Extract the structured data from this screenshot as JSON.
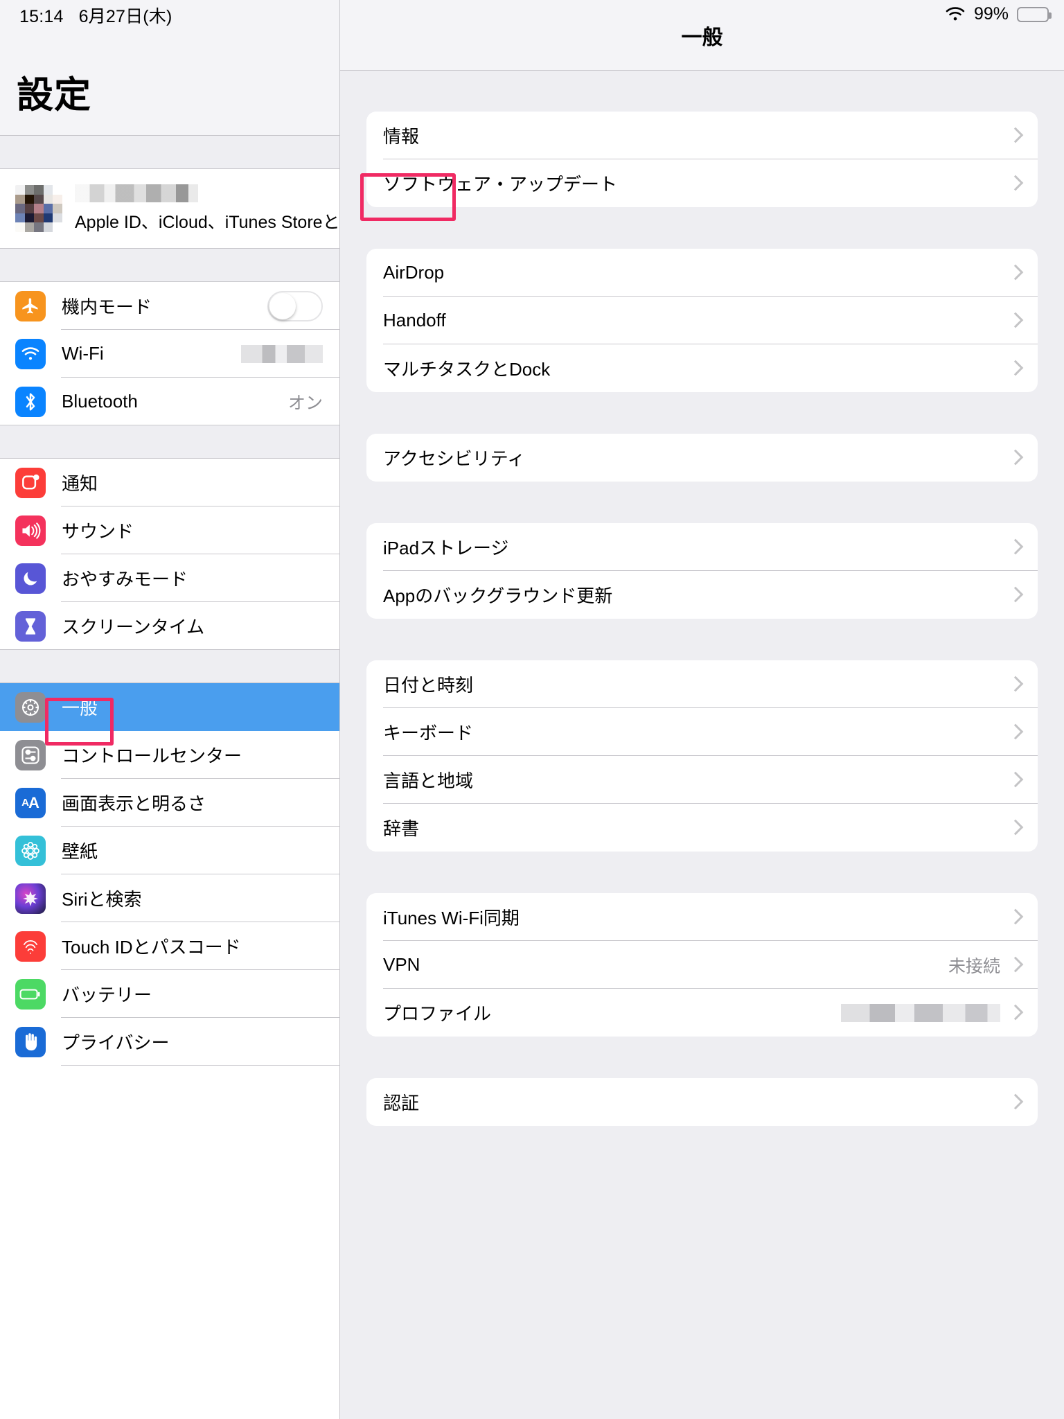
{
  "status_bar": {
    "time": "15:14",
    "date": "6月27日(木)",
    "battery_percent": "99%",
    "wifi_icon": "wifi-icon",
    "battery_icon": "battery-full-icon"
  },
  "sidebar": {
    "title": "設定",
    "account": {
      "name_masked": "",
      "subtitle": "Apple ID、iCloud、iTunes Storeと…"
    },
    "groups": [
      {
        "items": [
          {
            "label": "機内モード",
            "icon": "airplane-icon",
            "color": "#f7941e",
            "control": "toggle",
            "value": ""
          },
          {
            "label": "Wi-Fi",
            "icon": "wifi-icon",
            "color": "#0a84ff",
            "control": "masked-value",
            "value": ""
          },
          {
            "label": "Bluetooth",
            "icon": "bluetooth-icon",
            "color": "#0a84ff",
            "control": "value",
            "value": "オン"
          }
        ]
      },
      {
        "items": [
          {
            "label": "通知",
            "icon": "notifications-icon",
            "color": "#fc3d39",
            "control": "none",
            "value": ""
          },
          {
            "label": "サウンド",
            "icon": "sound-icon",
            "color": "#f4325c",
            "control": "none",
            "value": ""
          },
          {
            "label": "おやすみモード",
            "icon": "moon-icon",
            "color": "#5856d6",
            "control": "none",
            "value": ""
          },
          {
            "label": "スクリーンタイム",
            "icon": "hourglass-icon",
            "color": "#6361d8",
            "control": "none",
            "value": ""
          }
        ]
      },
      {
        "items": [
          {
            "label": "一般",
            "icon": "gear-icon",
            "color": "#8e8e93",
            "control": "none",
            "value": "",
            "selected": true,
            "annotated": true
          },
          {
            "label": "コントロールセンター",
            "icon": "switches-icon",
            "color": "#8e8e93",
            "control": "none",
            "value": ""
          },
          {
            "label": "画面表示と明るさ",
            "icon": "display-icon",
            "color": "#1a6bd6",
            "control": "none",
            "value": ""
          },
          {
            "label": "壁紙",
            "icon": "wallpaper-icon",
            "color": "#34c0d8",
            "control": "none",
            "value": ""
          },
          {
            "label": "Siriと検索",
            "icon": "siri-icon",
            "color": "#1c1c3a",
            "control": "none",
            "value": ""
          },
          {
            "label": "Touch IDとパスコード",
            "icon": "fingerprint-icon",
            "color": "#fc3d39",
            "control": "none",
            "value": ""
          },
          {
            "label": "バッテリー",
            "icon": "battery-icon",
            "color": "#4cd964",
            "control": "none",
            "value": ""
          },
          {
            "label": "プライバシー",
            "icon": "hand-icon",
            "color": "#1a6bd6",
            "control": "none",
            "value": ""
          }
        ]
      }
    ]
  },
  "detail": {
    "nav_title": "一般",
    "annotated_row": "AirDrop",
    "groups": [
      {
        "rows": [
          {
            "label": "情報",
            "value": "",
            "chevron": true
          },
          {
            "label": "ソフトウェア・アップデート",
            "value": "",
            "chevron": true
          }
        ]
      },
      {
        "rows": [
          {
            "label": "AirDrop",
            "value": "",
            "chevron": true,
            "annotated": true
          },
          {
            "label": "Handoff",
            "value": "",
            "chevron": true
          },
          {
            "label": "マルチタスクとDock",
            "value": "",
            "chevron": true
          }
        ]
      },
      {
        "rows": [
          {
            "label": "アクセシビリティ",
            "value": "",
            "chevron": true
          }
        ]
      },
      {
        "rows": [
          {
            "label": "iPadストレージ",
            "value": "",
            "chevron": true
          },
          {
            "label": "Appのバックグラウンド更新",
            "value": "",
            "chevron": true
          }
        ]
      },
      {
        "rows": [
          {
            "label": "日付と時刻",
            "value": "",
            "chevron": true
          },
          {
            "label": "キーボード",
            "value": "",
            "chevron": true
          },
          {
            "label": "言語と地域",
            "value": "",
            "chevron": true
          },
          {
            "label": "辞書",
            "value": "",
            "chevron": true
          }
        ]
      },
      {
        "rows": [
          {
            "label": "iTunes Wi-Fi同期",
            "value": "",
            "chevron": true
          },
          {
            "label": "VPN",
            "value": "未接続",
            "chevron": true
          },
          {
            "label": "プロファイル",
            "value": "",
            "masked": true,
            "chevron": true
          }
        ]
      },
      {
        "rows": [
          {
            "label": "認証",
            "value": "",
            "chevron": true
          }
        ]
      }
    ]
  },
  "colors": {
    "annotation": "#f02a63",
    "selection": "#4a9eee",
    "group_bg": "#eeeef2",
    "separator": "#c8c7cc"
  }
}
